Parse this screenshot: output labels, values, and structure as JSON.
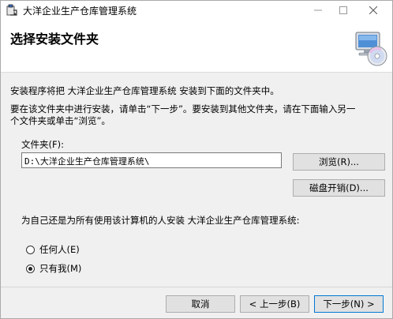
{
  "window": {
    "title": "大洋企业生产仓库管理系统",
    "controls": {
      "minimize": "—",
      "maximize": "☐",
      "close": "✕"
    }
  },
  "header": {
    "title": "选择安装文件夹",
    "icon": "computer-cd-icon"
  },
  "body": {
    "line1": "安装程序将把 大洋企业生产仓库管理系统 安装到下面的文件夹中。",
    "line2": "要在该文件夹中进行安装，请单击“下一步”。要安装到其他文件夹，请在下面输入另一",
    "line3": "个文件夹或单击“浏览”。"
  },
  "folder": {
    "label": "文件夹(F):",
    "value": "D:\\大洋企业生产仓库管理系统\\",
    "browse_label": "浏览(R)...",
    "disk_cost_label": "磁盘开销(D)..."
  },
  "install_for": {
    "label": "为自己还是为所有使用该计算机的人安装 大洋企业生产仓库管理系统:",
    "options": [
      {
        "label": "任何人(E)",
        "selected": false
      },
      {
        "label": "只有我(M)",
        "selected": true
      }
    ]
  },
  "footer": {
    "cancel_label": "取消",
    "back_label": "< 上一步(B)",
    "next_label": "下一步(N) >"
  }
}
